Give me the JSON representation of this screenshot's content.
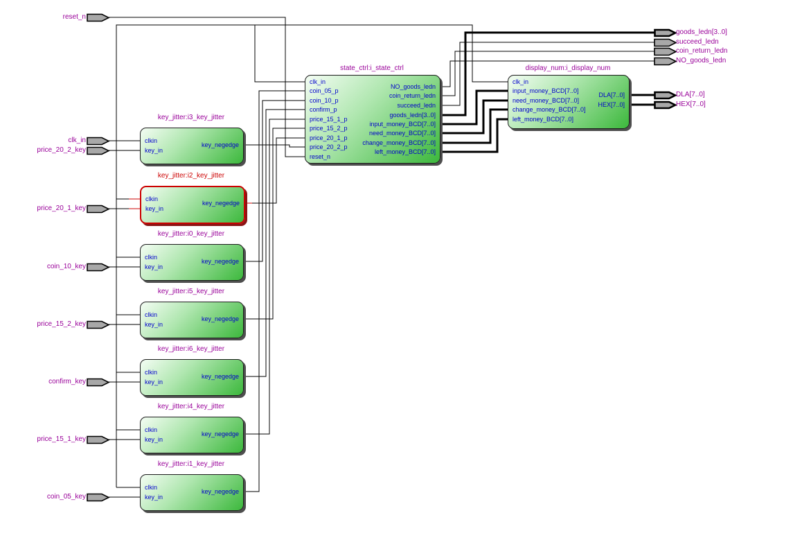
{
  "diagram": {
    "tool_context": "RTL schematic netlist view",
    "colors": {
      "block_fill_light": "#f4fdf4",
      "block_fill_dark": "#3cb83c",
      "block_border": "#1c1c1c",
      "selected_highlight": "#cc0000",
      "port_text": "#0000cc",
      "instance_title": "#990099",
      "pin_label": "#990099",
      "pin_fill": "#a8a8a8",
      "wire": "#000000",
      "background": "#ffffff"
    },
    "input_pins": [
      {
        "label": "reset_n"
      },
      {
        "label": "clk_in"
      },
      {
        "label": "price_20_2_key"
      },
      {
        "label": "price_20_1_key"
      },
      {
        "label": "coin_10_key"
      },
      {
        "label": "price_15_2_key"
      },
      {
        "label": "confirm_key"
      },
      {
        "label": "price_15_1_key"
      },
      {
        "label": "coin_05_key"
      }
    ],
    "output_pins": [
      {
        "label": "goods_ledn[3..0]",
        "bus": true
      },
      {
        "label": "succeed_ledn",
        "bus": false
      },
      {
        "label": "coin_return_ledn",
        "bus": false
      },
      {
        "label": "NO_goods_ledn",
        "bus": false
      },
      {
        "label": "DLA[7..0]",
        "bus": true
      },
      {
        "label": "HEX[7..0]",
        "bus": true
      }
    ],
    "key_jitter_blocks": [
      {
        "title": "key_jitter:i3_key_jitter",
        "in": [
          "clkin",
          "key_in"
        ],
        "out": "key_negedge",
        "selected": false
      },
      {
        "title": "key_jitter:i2_key_jitter",
        "in": [
          "clkin",
          "key_in"
        ],
        "out": "key_negedge",
        "selected": true
      },
      {
        "title": "key_jitter:i0_key_jitter",
        "in": [
          "clkin",
          "key_in"
        ],
        "out": "key_negedge",
        "selected": false
      },
      {
        "title": "key_jitter:i5_key_jitter",
        "in": [
          "clkin",
          "key_in"
        ],
        "out": "key_negedge",
        "selected": false
      },
      {
        "title": "key_jitter:i6_key_jitter",
        "in": [
          "clkin",
          "key_in"
        ],
        "out": "key_negedge",
        "selected": false
      },
      {
        "title": "key_jitter:i4_key_jitter",
        "in": [
          "clkin",
          "key_in"
        ],
        "out": "key_negedge",
        "selected": false
      },
      {
        "title": "key_jitter:i1_key_jitter",
        "in": [
          "clkin",
          "key_in"
        ],
        "out": "key_negedge",
        "selected": false
      }
    ],
    "state_ctrl": {
      "title": "state_ctrl:i_state_ctrl",
      "left_ports": [
        "clk_in",
        "coin_05_p",
        "coin_10_p",
        "confirm_p",
        "price_15_1_p",
        "price_15_2_p",
        "price_20_1_p",
        "price_20_2_p",
        "reset_n"
      ],
      "right_ports": [
        "NO_goods_ledn",
        "coin_return_ledn",
        "succeed_ledn",
        "goods_ledn[3..0]",
        "input_money_BCD[7..0]",
        "need_money_BCD[7..0]",
        "change_money_BCD[7..0]",
        "left_money_BCD[7..0]"
      ]
    },
    "display_num": {
      "title": "display_num:i_display_num",
      "left_ports": [
        "clk_in",
        "input_money_BCD[7..0]",
        "need_money_BCD[7..0]",
        "change_money_BCD[7..0]",
        "left_money_BCD[7..0]"
      ],
      "right_ports": [
        "DLA[7..0]",
        "HEX[7..0]"
      ]
    }
  }
}
